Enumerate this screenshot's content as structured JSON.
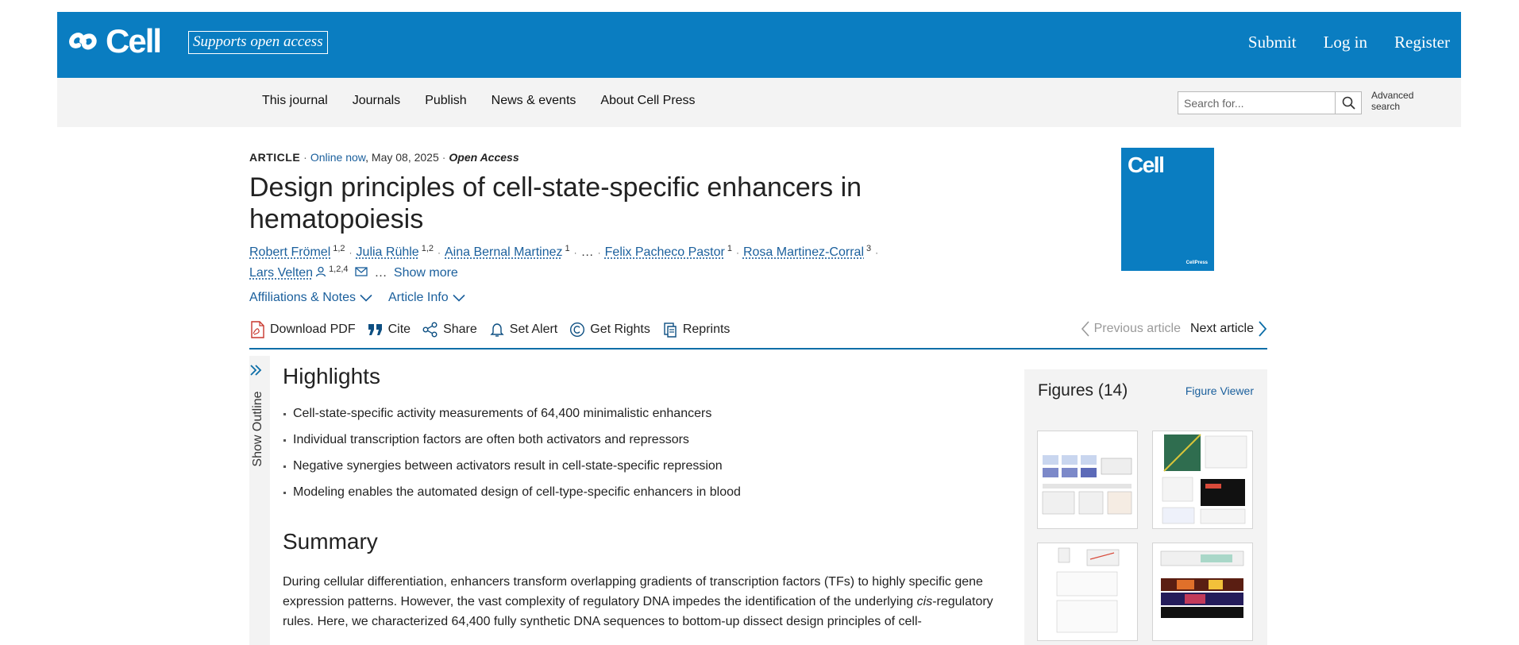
{
  "header": {
    "logo_text": "Cell",
    "open_access_badge": "Supports open access",
    "links": [
      "Submit",
      "Log in",
      "Register"
    ],
    "brand_color": "#0a7dc1"
  },
  "nav": {
    "items": [
      "This journal",
      "Journals",
      "Publish",
      "News & events",
      "About Cell Press"
    ],
    "search_placeholder": "Search for...",
    "advanced_search": [
      "Advanced",
      "search"
    ]
  },
  "article": {
    "type": "ARTICLE",
    "online": "Online now",
    "date": "May 08, 2025",
    "access": "Open Access",
    "title": "Design principles of cell-state-specific enhancers in hematopoiesis",
    "authors": [
      {
        "name": "Robert Frömel",
        "aff": "1,2"
      },
      {
        "name": "Julia Rühle",
        "aff": "1,2"
      },
      {
        "name": "Aina Bernal Martinez",
        "aff": "1"
      },
      {
        "name": "Felix Pacheco Pastor",
        "aff": "1"
      },
      {
        "name": "Rosa Martinez-Corral",
        "aff": "3"
      },
      {
        "name": "Lars Velten",
        "aff": "1,2,4"
      }
    ],
    "ellipsis": "…",
    "show_more": "Show more",
    "affiliations_link": "Affiliations & Notes",
    "article_info_link": "Article Info",
    "cover_title": "Cell",
    "cover_publisher": "CellPress"
  },
  "toolbar": {
    "download_pdf": "Download PDF",
    "cite": "Cite",
    "share": "Share",
    "set_alert": "Set Alert",
    "get_rights": "Get Rights",
    "reprints": "Reprints",
    "previous": "Previous article",
    "next": "Next article"
  },
  "outline": {
    "label": "Show Outline"
  },
  "highlights": {
    "heading": "Highlights",
    "items": [
      "Cell-state-specific activity measurements of 64,400 minimalistic enhancers",
      "Individual transcription factors are often both activators and repressors",
      "Negative synergies between activators result in cell-state-specific repression",
      "Modeling enables the automated design of cell-type-specific enhancers in blood"
    ]
  },
  "summary": {
    "heading": "Summary",
    "text_1": "During cellular differentiation, enhancers transform overlapping gradients of transcription factors (TFs) to highly specific gene expression patterns. However, the vast complexity of regulatory DNA impedes the identification of the underlying ",
    "text_italic": "cis",
    "text_2": "-regulatory rules. Here, we characterized 64,400 fully synthetic DNA sequences to bottom-up dissect design principles of cell-"
  },
  "figures": {
    "title": "Figures (14)",
    "viewer_link": "Figure Viewer"
  }
}
